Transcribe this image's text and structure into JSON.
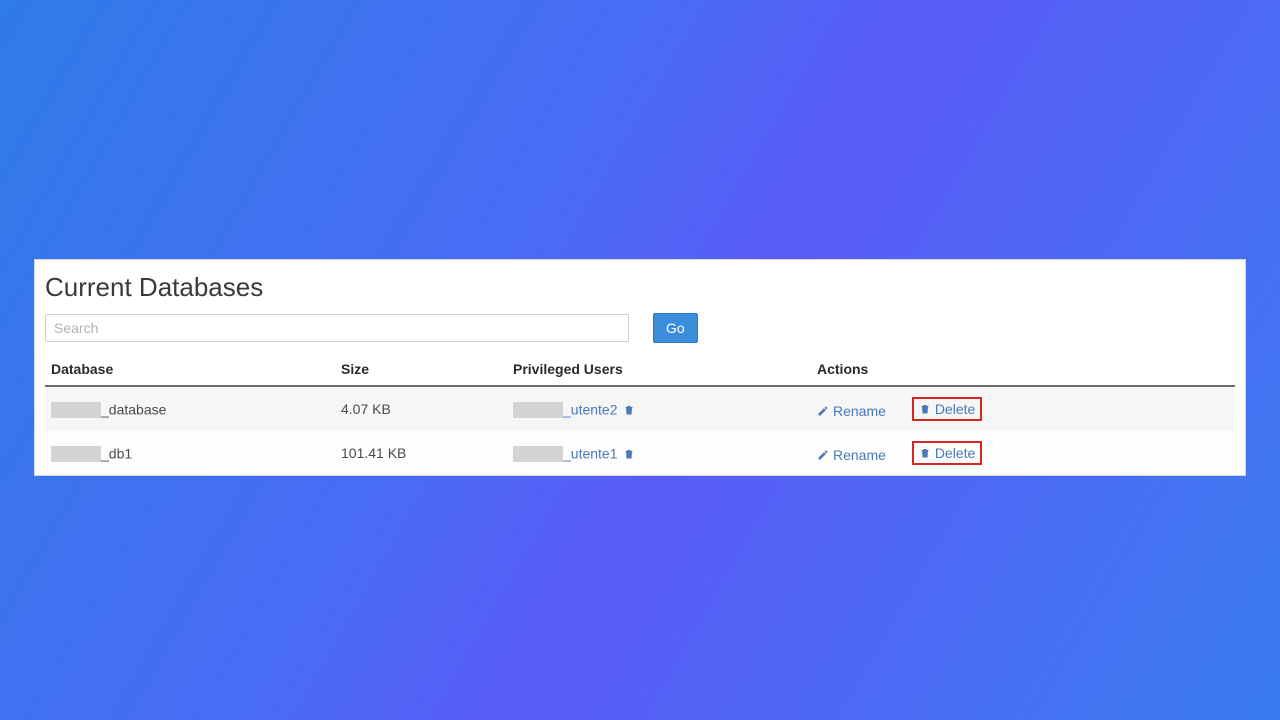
{
  "title": "Current Databases",
  "search": {
    "placeholder": "Search",
    "go_label": "Go"
  },
  "columns": {
    "database": "Database",
    "size": "Size",
    "users": "Privileged Users",
    "actions": "Actions"
  },
  "actions": {
    "rename": "Rename",
    "delete": "Delete"
  },
  "rows": [
    {
      "db_suffix": "_database",
      "size": "4.07 KB",
      "user_suffix": "_utente2"
    },
    {
      "db_suffix": "_db1",
      "size": "101.41 KB",
      "user_suffix": "_utente1"
    }
  ],
  "colors": {
    "link": "#4a79b6",
    "highlight_border": "#d72626",
    "go_button": "#3b8cdb"
  }
}
